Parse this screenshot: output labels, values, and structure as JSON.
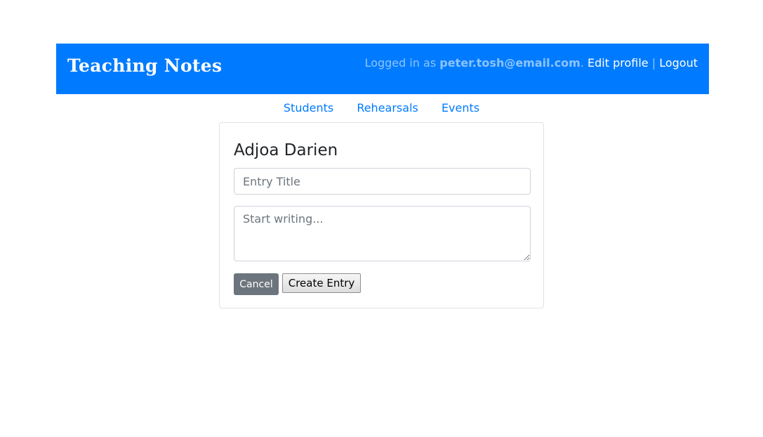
{
  "header": {
    "brand": "Teaching Notes",
    "logged_in_prefix": "Logged in as ",
    "user_email": "peter.tosh@email.com",
    "email_suffix": ".",
    "edit_profile": "Edit profile",
    "separator": "|",
    "logout": "Logout"
  },
  "nav": {
    "items": [
      "Students",
      "Rehearsals",
      "Events"
    ]
  },
  "card": {
    "title": "Adjoa Darien",
    "entry_title_placeholder": "Entry Title",
    "entry_body_placeholder": "Start writing...",
    "cancel_label": "Cancel",
    "create_label": "Create Entry"
  },
  "colors": {
    "primary": "#007bff",
    "secondary": "#6c757d"
  }
}
